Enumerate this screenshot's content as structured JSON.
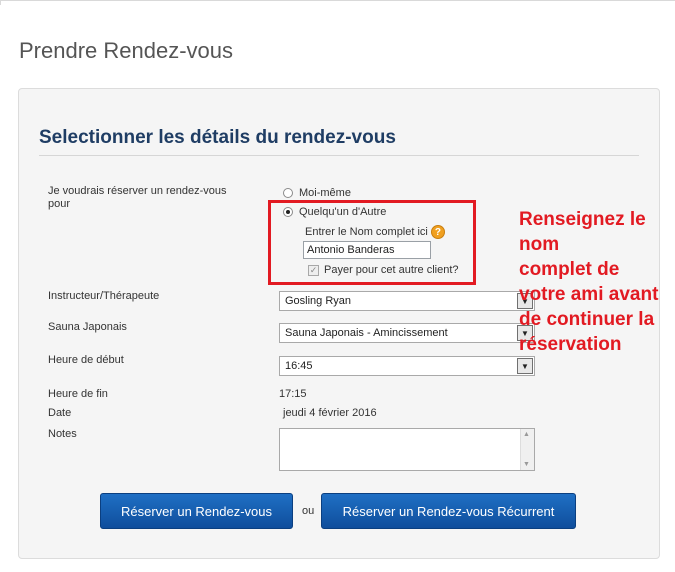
{
  "page": {
    "title": "Prendre Rendez-vous"
  },
  "section": {
    "title": "Selectionner les détails du rendez-vous"
  },
  "for_whom": {
    "label": "Je voudrais réserver un rendez-vous pour",
    "option_self": "Moi-même",
    "option_other": "Quelqu'un d'Autre",
    "selected": "option_other",
    "name_prompt": "Entrer le Nom complet ici",
    "help_icon": "question-mark-icon",
    "name_value": "Antonio Banderas",
    "pay_label": "Payer pour cet autre client?",
    "pay_checked": true
  },
  "therapist": {
    "label": "Instructeur/Thérapeute",
    "value": "Gosling Ryan"
  },
  "service": {
    "label": "Sauna Japonais",
    "value": "Sauna Japonais - Amincissement"
  },
  "start_time": {
    "label": "Heure de début",
    "value": "16:45"
  },
  "end_time": {
    "label": "Heure de fin",
    "value": "17:15"
  },
  "date": {
    "label": "Date",
    "value": "jeudi 4 février 2016"
  },
  "notes": {
    "label": "Notes",
    "value": ""
  },
  "buttons": {
    "book": "Réserver un Rendez-vous",
    "separator": "ou",
    "book_recurring": "Réserver un Rendez-vous Récurrent"
  },
  "annotation": {
    "line1": "Renseignez le",
    "line2": "nom",
    "line3": "complet de",
    "line4": "votre ami avant",
    "line5": "de continuer la",
    "line6": "réservation"
  },
  "colors": {
    "accent": "#1f3d64",
    "button": "#1565b8",
    "highlight": "#e21a22"
  }
}
